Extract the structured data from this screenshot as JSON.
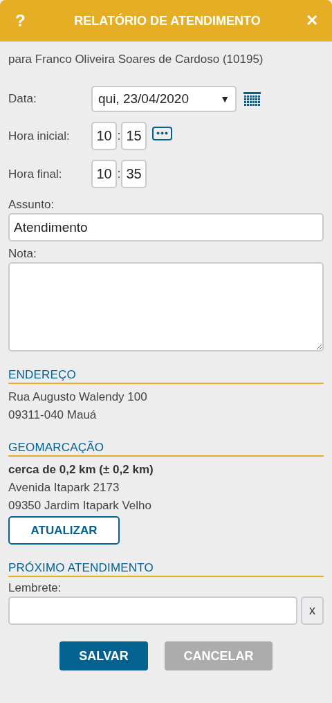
{
  "header": {
    "help": "?",
    "title": "RELATÓRIO DE ATENDIMENTO",
    "close": "✕"
  },
  "subtitle": "para Franco Oliveira Soares de Cardoso (10195)",
  "form": {
    "date": {
      "label": "Data:",
      "value": "qui, 23/04/2020",
      "arrow": "▼"
    },
    "start": {
      "label": "Hora inicial:",
      "hour": "10",
      "separator": ":",
      "minute": "15"
    },
    "end": {
      "label": "Hora final:",
      "hour": "10",
      "separator": ":",
      "minute": "35"
    },
    "subject": {
      "label": "Assunto:",
      "value": "Atendimento"
    },
    "note": {
      "label": "Nota:"
    }
  },
  "sections": [
    {
      "title": "ENDEREÇO",
      "lines": [
        {
          "text": "Rua Augusto Walendy 100",
          "bold": false
        },
        {
          "text": "09311-040 Mauá",
          "bold": false
        }
      ]
    },
    {
      "title": "GEOMARCAÇÃO",
      "lines": [
        {
          "text": "cerca de 0,2 km (± 0,2 km)",
          "bold": true
        },
        {
          "text": "Avenida Itapark 2173",
          "bold": false
        },
        {
          "text": "09350 Jardim Itapark Velho",
          "bold": false
        }
      ],
      "button": "ATUALIZAR"
    },
    {
      "title": "PRÓXIMO ATENDIMENTO",
      "reminder": {
        "label": "Lembrete:",
        "clear": "x"
      }
    }
  ],
  "buttons": [
    {
      "label": "SALVAR",
      "kind": "primary"
    },
    {
      "label": "CANCELAR",
      "kind": "secondary"
    }
  ]
}
